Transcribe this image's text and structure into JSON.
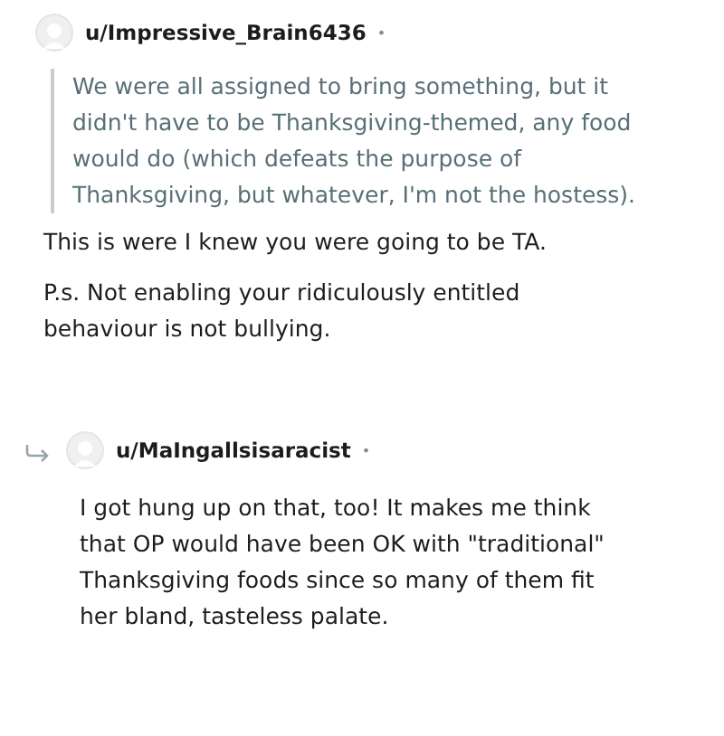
{
  "comments": [
    {
      "author": "u/Impressive_Brain6436",
      "separator": "•",
      "reply": false,
      "blocks": [
        {
          "kind": "quote",
          "text": "We were all assigned to bring something, but it didn't have to be Thanksgiving-themed, any food would do (which defeats the purpose of Thanksgiving, but whatever, I'm not the hostess)."
        },
        {
          "kind": "paragraph",
          "text": "This is were I knew you were going to be TA."
        },
        {
          "kind": "paragraph",
          "text": "P.s. Not enabling your ridiculously entitled behaviour is not bullying."
        }
      ]
    },
    {
      "author": "u/MaIngallsisaracist",
      "separator": "•",
      "reply": true,
      "blocks": [
        {
          "kind": "paragraph",
          "text": "I got hung up on that, too! It makes me think that OP would have been OK with \"traditional\" Thanksgiving foods since so many of them fit her bland, tasteless palate."
        }
      ]
    }
  ]
}
